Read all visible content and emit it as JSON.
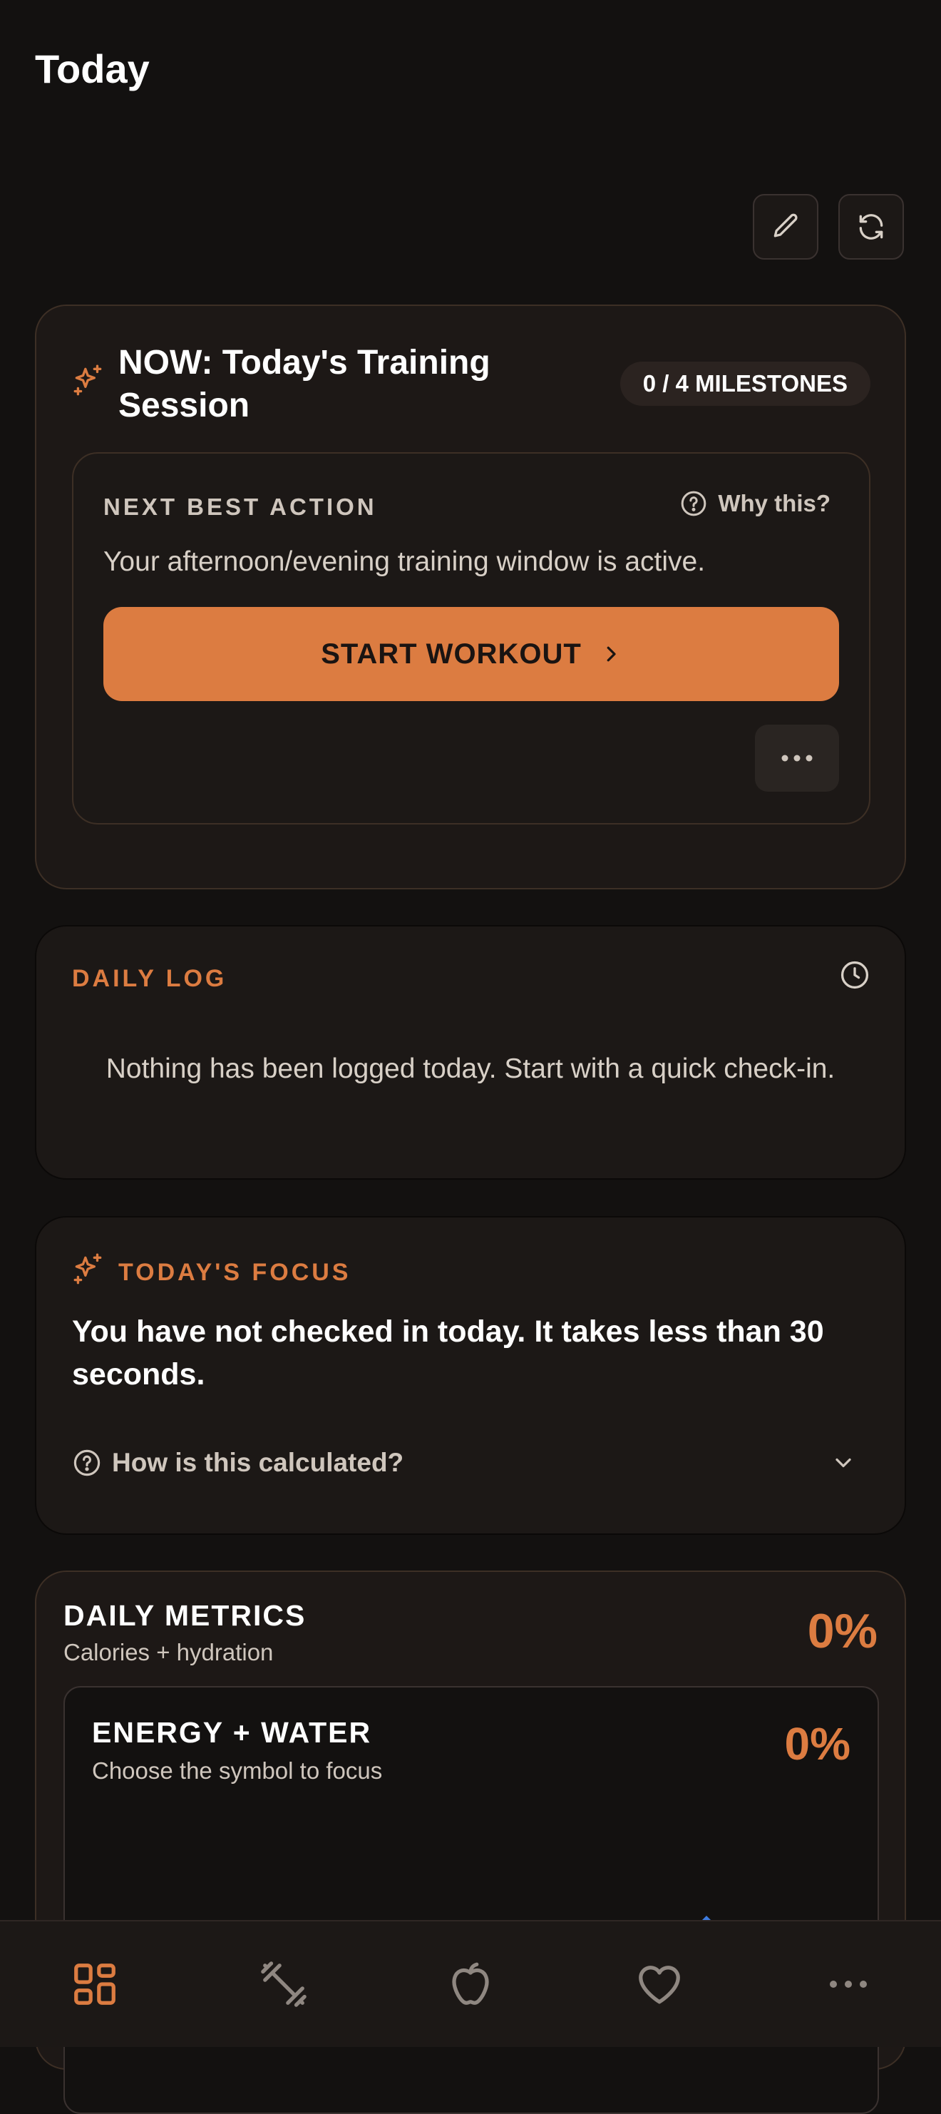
{
  "header": {
    "title": "Today"
  },
  "toolbar": {
    "edit_icon": "pencil-icon",
    "refresh_icon": "refresh-icon"
  },
  "now_card": {
    "title": "NOW: Today's Training Session",
    "icon": "sparkles-icon",
    "milestones": "0 / 4 MILESTONES",
    "next_best_action": {
      "label": "NEXT BEST ACTION",
      "why_label": "Why this?",
      "description": "Your afternoon/evening training window is active.",
      "primary_button": "START WORKOUT",
      "more_icon": "more-horizontal-icon"
    }
  },
  "daily_log": {
    "label": "DAILY LOG",
    "icon": "clock-icon",
    "empty_text": "Nothing has been logged today. Start with a quick check-in."
  },
  "focus": {
    "label": "TODAY'S FOCUS",
    "text": "You have not checked in today. It takes less than 30 seconds.",
    "how_label": "How is this calculated?"
  },
  "metrics": {
    "title": "DAILY METRICS",
    "subtitle": "Calories + hydration",
    "percent": "0%",
    "energy_water": {
      "title": "ENERGY + WATER",
      "subtitle": "Choose the symbol to focus",
      "percent": "0%"
    }
  },
  "tabs": [
    {
      "name": "dashboard",
      "icon": "grid-icon",
      "active": true
    },
    {
      "name": "training",
      "icon": "dumbbell-icon",
      "active": false
    },
    {
      "name": "nutrition",
      "icon": "apple-icon",
      "active": false
    },
    {
      "name": "health",
      "icon": "heart-icon",
      "active": false
    },
    {
      "name": "more",
      "icon": "more-horizontal-icon",
      "active": false
    }
  ],
  "colors": {
    "accent": "#dc7c41",
    "background": "#131110",
    "card": "#1d1816"
  }
}
